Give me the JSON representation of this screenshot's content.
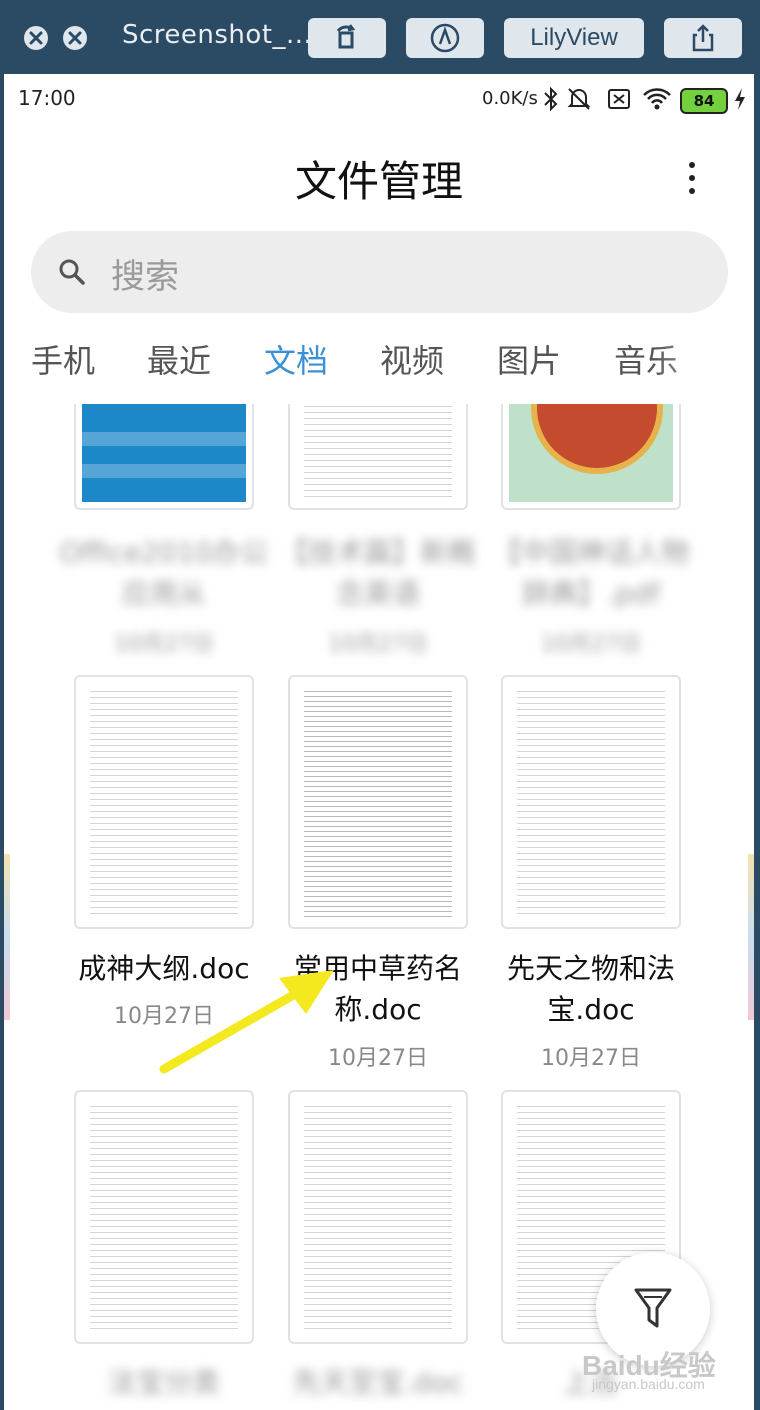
{
  "viewer": {
    "title": "Screenshot_...",
    "app_button": "LilyView"
  },
  "status": {
    "time": "17:00",
    "speed": "0.0K/s",
    "battery": "84"
  },
  "app": {
    "title": "文件管理",
    "search_placeholder": "搜索"
  },
  "tabs": [
    {
      "label": "手机",
      "active": false
    },
    {
      "label": "最近",
      "active": false
    },
    {
      "label": "文档",
      "active": true
    },
    {
      "label": "视频",
      "active": false
    },
    {
      "label": "图片",
      "active": false
    },
    {
      "label": "音乐",
      "active": false
    }
  ],
  "files": {
    "row1": [
      {
        "name": "Office2010办公应用从",
        "date": "10月27日"
      },
      {
        "name": "【技术篇】新概念英语",
        "date": "10月27日"
      },
      {
        "name": "【中国神话人物辞典】.pdf",
        "date": "10月27日"
      }
    ],
    "row2": [
      {
        "name": "成神大纲.doc",
        "date": "10月27日"
      },
      {
        "name": "常用中草药名称.doc",
        "date": "10月27日"
      },
      {
        "name": "先天之物和法宝.doc",
        "date": "10月27日"
      }
    ],
    "row3": [
      {
        "name": "法宝分类",
        "date": ""
      },
      {
        "name": "先天至宝.doc",
        "date": ""
      },
      {
        "name": "上古",
        "date": ""
      }
    ]
  },
  "watermark": {
    "brand": "Baidu经验",
    "url": "jingyan.baidu.com"
  },
  "colors": {
    "accent": "#3a8fd8",
    "annotation_arrow": "#f4e81e"
  }
}
